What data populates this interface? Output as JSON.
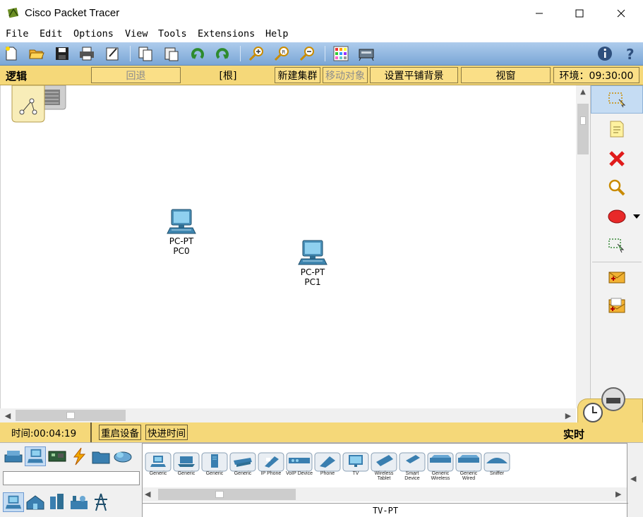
{
  "window": {
    "title": "Cisco Packet Tracer"
  },
  "menu": [
    "File",
    "Edit",
    "Options",
    "View",
    "Tools",
    "Extensions",
    "Help"
  ],
  "nav": {
    "mode_label": "逻辑",
    "back": "回退",
    "root": "[根]",
    "new_cluster": "新建集群",
    "move_object": "移动对象",
    "set_background": "设置平铺背景",
    "viewport": "视窗",
    "environment": "环境：09:30:00"
  },
  "canvas": {
    "devices": [
      {
        "type": "PC-PT",
        "name": "PC0"
      },
      {
        "type": "PC-PT",
        "name": "PC1"
      }
    ]
  },
  "status": {
    "time": "时间:00:04:19",
    "power_cycle": "重启设备",
    "fast_forward": "快进时间",
    "mode": "实时"
  },
  "palette": {
    "devices": [
      "Generic",
      "Generic",
      "Generic",
      "Generic",
      "IP Phone",
      "VoIP Device",
      "Phone",
      "TV",
      "Wireless Tablet",
      "Smart Device",
      "Generic Wireless",
      "Generic Wired",
      "Sniffer"
    ],
    "selected_model": "TV-PT",
    "search_value": ""
  },
  "colors": {
    "toolbar": "#8fb6e2",
    "nav": "#f5d879",
    "accent_selected": "#c5dcf3"
  }
}
